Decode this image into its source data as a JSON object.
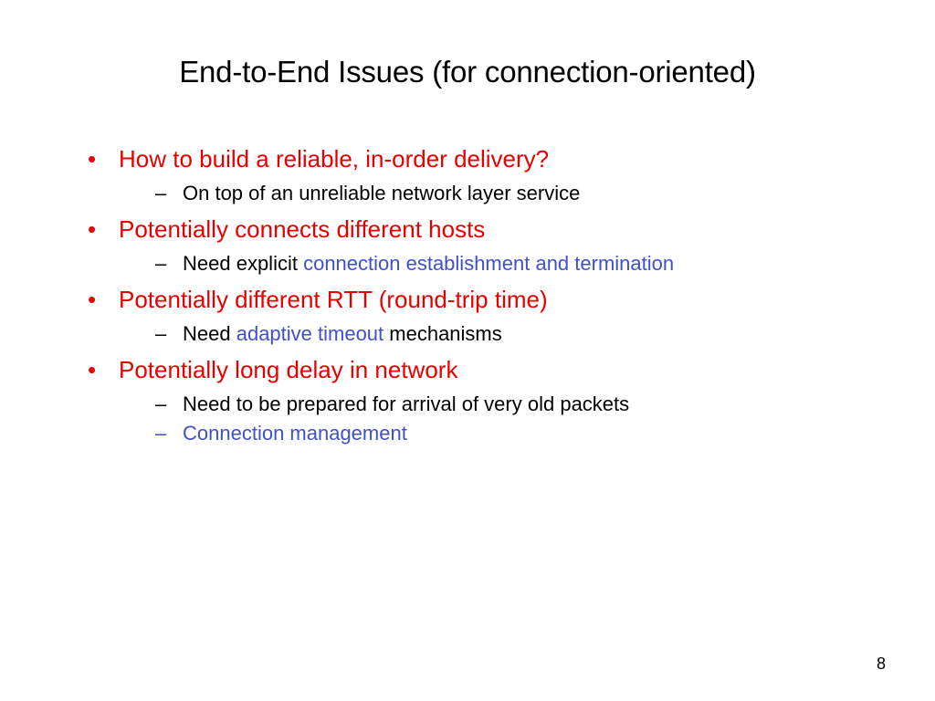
{
  "title": "End-to-End Issues (for connection-oriented)",
  "bullets": [
    {
      "text": "How to build a reliable, in-order delivery?",
      "subs": [
        {
          "parts": [
            {
              "t": "On top of an unreliable network layer service",
              "c": "black"
            }
          ],
          "dash": "black"
        }
      ]
    },
    {
      "text": "Potentially connects different hosts",
      "subs": [
        {
          "parts": [
            {
              "t": "Need explicit ",
              "c": "black"
            },
            {
              "t": "connection establishment and termination",
              "c": "blue"
            }
          ],
          "dash": "black"
        }
      ]
    },
    {
      "text": "Potentially different RTT (round-trip time)",
      "subs": [
        {
          "parts": [
            {
              "t": "Need ",
              "c": "black"
            },
            {
              "t": "adaptive timeout",
              "c": "blue"
            },
            {
              "t": " mechanisms",
              "c": "black"
            }
          ],
          "dash": "black"
        }
      ]
    },
    {
      "text": "Potentially long delay in network",
      "subs": [
        {
          "parts": [
            {
              "t": "Need to be prepared for arrival of very old packets",
              "c": "black"
            }
          ],
          "dash": "black"
        },
        {
          "parts": [
            {
              "t": "Connection management",
              "c": "blue"
            }
          ],
          "dash": "blue"
        }
      ]
    }
  ],
  "page_number": "8"
}
